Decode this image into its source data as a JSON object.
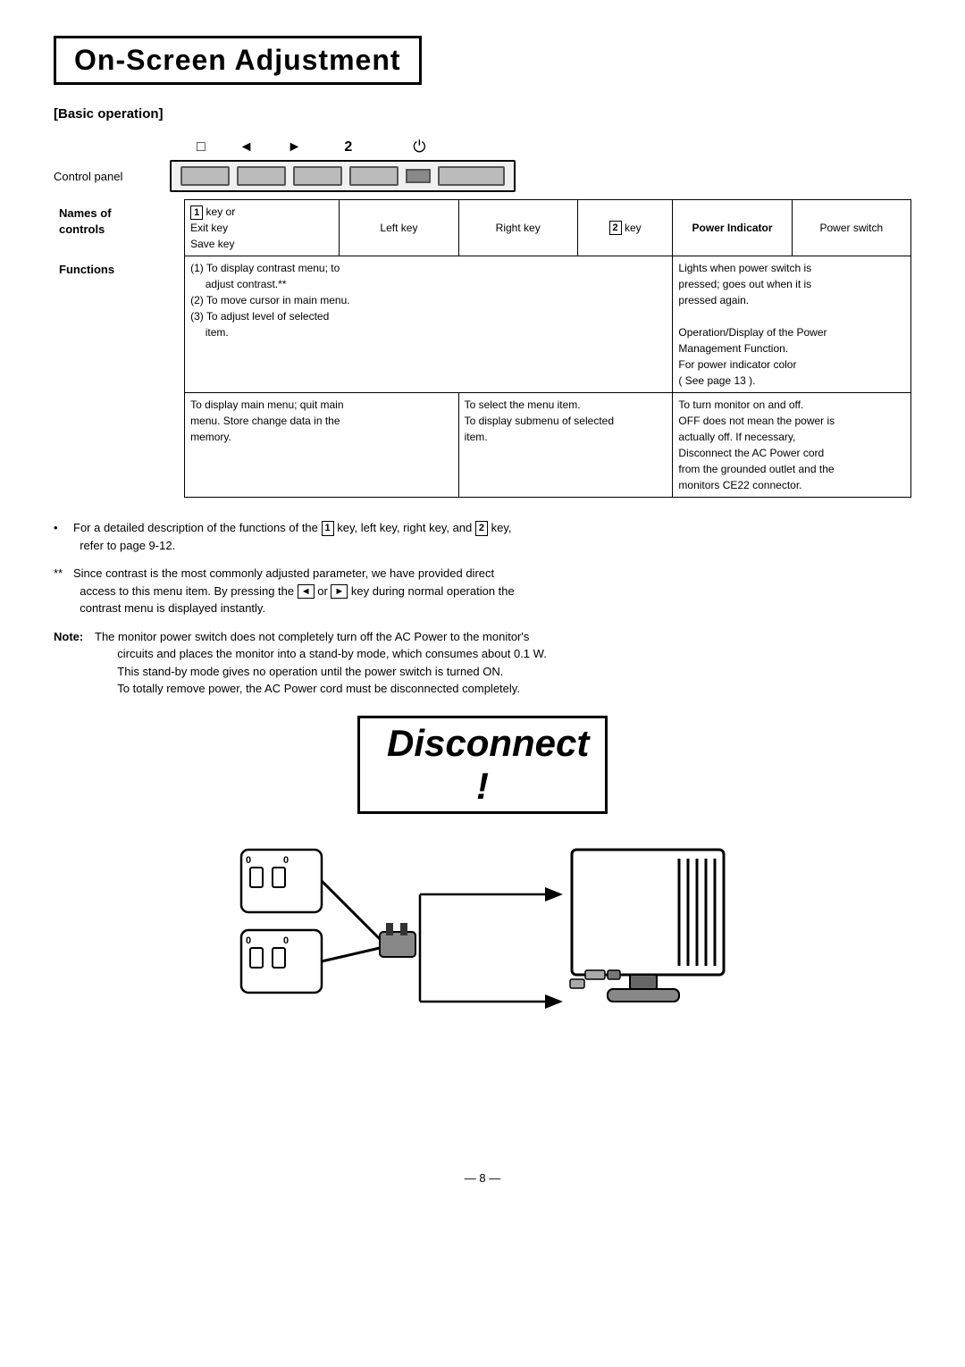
{
  "page": {
    "title": "On-Screen Adjustment",
    "section": "[Basic operation]",
    "page_number": "— 8 —"
  },
  "diagram": {
    "control_panel_label": "Control panel",
    "names_of_controls_label": "Names of\ncontrols",
    "functions_label": "Functions",
    "icons": [
      "□",
      "◄",
      "►",
      "2",
      "⏻"
    ],
    "control_names": {
      "key1": "[1] key or\nExit key\nSave key",
      "left_key": "Left key",
      "right_key": "Right key",
      "key2": "[2] key",
      "power_indicator": "Power\nIndicator",
      "power_switch": "Power switch"
    },
    "functions": {
      "keys_function": "(1) To display contrast menu; to\n     adjust contrast.**\n(2) To move cursor in main menu.\n(3) To adjust level of selected\n     item.",
      "power_function": "Lights when power switch is\npressed; goes out when it is\npressed again.\nOperation/Display of the Power\nManagement Function.\nFor power indicator color\n( See page 13 ).",
      "bottom_keys": "To display main menu; quit main\nmenu. Store change data in the\nmemory.",
      "bottom_select": "To select the menu item.\nTo display submenu of selected\nitem.",
      "bottom_power": "To turn monitor on and off.\nOFF does not mean the power is\nactually off. If necessary,\nDisconnect the AC Power cord\nfrom the grounded outlet and the\nmonitors CE22 connector."
    }
  },
  "notes": {
    "bullet1_prefix": "•",
    "bullet1_text": "For a detailed description of the functions of the ",
    "bullet1_key1": "1",
    "bullet1_mid": " key, left key, right key, and ",
    "bullet1_key2": "2",
    "bullet1_end": " key,\n    refer to page 9-12.",
    "bullet2_prefix": "**",
    "bullet2_text": "Since contrast is the most commonly adjusted parameter, we have provided direct\n    access to this menu item. By pressing the ",
    "bullet2_key1": "◄",
    "bullet2_mid": " or ",
    "bullet2_key2": "►",
    "bullet2_end": " key during normal operation the\n    contrast menu is displayed instantly.",
    "note_prefix": "Note:",
    "note_text": "The monitor power switch does not completely turn off the AC Power to the monitor's\n        circuits and places the monitor into a stand-by mode, which consumes about 0.1 W.\n        This stand-by mode gives no operation until the power switch is turned ON.\n        To totally remove power, the AC Power cord must be disconnected completely."
  },
  "disconnect": {
    "title": "Disconnect !"
  }
}
